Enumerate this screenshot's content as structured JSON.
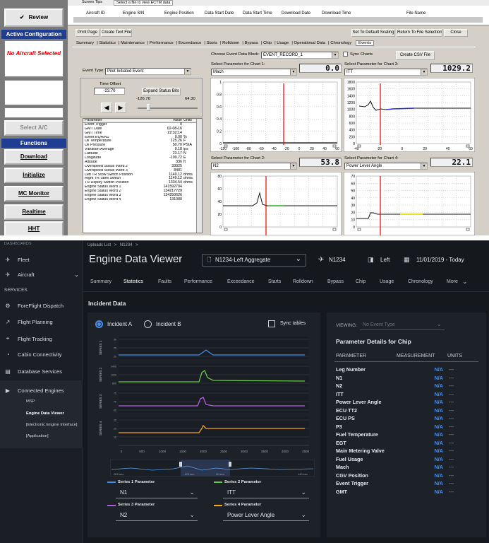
{
  "legacy": {
    "screen_tips": "Screen Tips",
    "screen_tip_text": "Select a file to view ECTM data",
    "file_columns": [
      "Aircraft ID",
      "Engine S/N",
      "Engine Position",
      "Data Start Date",
      "Data Start Time",
      "Download Date",
      "Download Time",
      "File Name"
    ],
    "sidebar": {
      "review": "Review",
      "active_config": "Active Configuration",
      "no_aircraft": "No Aircraft Selected",
      "select_ac": "Select A/C",
      "functions": "Functions",
      "download": "Download",
      "initialize": "Initialize",
      "mc_monitor": "MC Monitor",
      "realtime": "Realtime",
      "hht": "HHT"
    },
    "toolbar": {
      "print_page": "Print Page",
      "create_text_file": "Create Text File",
      "set_default_scaling": "Set To Default Scaling",
      "return_file_selection": "Return To File Selection",
      "close": "Close"
    },
    "tabs": [
      "Summary",
      "Statistics",
      "Maintenance",
      "Performance",
      "Exceedance",
      "Starts",
      "Rolldown",
      "Bypass",
      "Chip",
      "Usage",
      "Operational Data",
      "Chronology",
      "Events"
    ],
    "choose_event_label": "Choose Event Data Block:",
    "event_block": "EVENT_RECORD_1",
    "sync_charts": "Sync Charts",
    "create_csv": "Create CSV File",
    "event_type_label": "Event Type:",
    "event_type": "Pilot Initiated Event",
    "time_offset_label": "Time Offset",
    "time_offset": "-23.70",
    "expand_status": "Expand Status Bits",
    "range_min": "-126.70",
    "range_max": "64.30",
    "chart_labels": [
      "Select Parameter for Chart 1:",
      "Select Parameter for Chart 2:",
      "Select Parameter for Chart 3:",
      "Select Parameter for Chart 4:"
    ],
    "chart_params": [
      "Mach",
      "N2",
      "ITT",
      "Power Lever Angle"
    ],
    "chart_lcd": [
      "0.0",
      "53.8",
      "1029.2",
      "22.1"
    ],
    "table_headers": [
      "Parameter",
      "Value",
      "Units"
    ],
    "table_rows": [
      [
        "Event Trigger",
        "0",
        ""
      ],
      [
        "GMT Date",
        "02-08-16",
        ""
      ],
      [
        "GMT Time",
        "22:32:14",
        ""
      ],
      [
        "Event EQA/N1",
        "0.00",
        "%"
      ],
      [
        "Oil Temperature",
        "125.26",
        "F"
      ],
      [
        "Oil Pressure",
        "50.70",
        "PSIA"
      ],
      [
        "Vibration Average",
        "0.18",
        "ips"
      ],
      [
        "Latitude",
        "23.17",
        "N"
      ],
      [
        "Longitude",
        "-109.72",
        "E"
      ],
      [
        "Altitude",
        "336",
        "ft"
      ],
      [
        "Overspeed Status Word 2",
        "33025",
        ""
      ],
      [
        "Overspeed Status Word 3",
        "8481",
        ""
      ],
      [
        "Left TR Stow Switch Position",
        "1149.12",
        "ohms"
      ],
      [
        "Right TR Stow Switch",
        "1149.12",
        "ohms"
      ],
      [
        "TR Deploy Switch Position",
        "1334.54",
        "ohms"
      ],
      [
        "Engine Status Word 1",
        "141592704",
        ""
      ],
      [
        "Engine Status Word 2",
        "134217729",
        ""
      ],
      [
        "Engine Status Word 3",
        "134250626",
        ""
      ],
      [
        "Engine Status Word 4",
        "131080",
        ""
      ]
    ],
    "chart1": {
      "x_ticks": [
        "-120",
        "-100",
        "-80",
        "-60",
        "-40",
        "-20",
        "0",
        "20",
        "40",
        "60"
      ],
      "y_ticks": [
        "1",
        "0.8",
        "0.6",
        "0.4",
        "0.2",
        "0"
      ]
    },
    "chart3": {
      "x_ticks": [
        "-40",
        "-20",
        "0",
        "20",
        "40",
        "60"
      ],
      "y_ticks": [
        "1800",
        "1600",
        "1400",
        "1200",
        "1000",
        "800",
        "600",
        "400",
        "200",
        "0"
      ]
    },
    "chart2": {
      "y_ticks": [
        "80",
        "60",
        "40",
        "20",
        "0"
      ]
    },
    "chart4": {
      "y_ticks": [
        "70",
        "60",
        "50",
        "40",
        "30",
        "20",
        "10",
        "0"
      ]
    }
  },
  "modern": {
    "nav": {
      "dashboards": "DASHBOARDS",
      "fleet": "Fleet",
      "aircraft": "Aircraft",
      "services": "SERVICES",
      "foreflight": "ForeFlight Dispatch",
      "flight_planning": "Flight Planning",
      "flight_tracking": "Flight Tracking",
      "cabin": "Cabin Connectivity",
      "database": "Database Services",
      "connected_engines": "Connected Engines",
      "msp": "MSP",
      "engine_viewer": "Engine Data Viewer",
      "eei": "[Electronic Engine Interface]",
      "application": "[Application]"
    },
    "breadcrumb": [
      "Uploads List",
      ">",
      "N1234",
      ">"
    ],
    "page_title": "Engine Data Viewer",
    "file_select": "N1234-Left Aggregate",
    "aircraft": "N1234",
    "engine_side": "Left",
    "date_range": "11/01/2019 - Today",
    "tabs": [
      "Summary",
      "Statistics",
      "Faults",
      "Performance",
      "Exceedance",
      "Starts",
      "Rolldown",
      "Bypass",
      "Chip",
      "Usage",
      "Chronology",
      "More"
    ],
    "section_title": "Incident Data",
    "incident_a": "Incident A",
    "incident_b": "Incident B",
    "sync_tables": "Sync tables",
    "series_labels": [
      "SERIES 1",
      "SERIES 2",
      "SERIES 3",
      "SERIES 4"
    ],
    "s1_ticks": [
      "30",
      "25",
      "20"
    ],
    "s2_ticks": [
      "1400",
      "1000",
      "800"
    ],
    "s3_ticks": [
      "75",
      "70",
      "65"
    ],
    "s4_ticks": [
      "25",
      "20",
      "15"
    ],
    "x_ticks": [
      "0",
      "500",
      "1000",
      "1500",
      "2000",
      "2500",
      "3000",
      "3500",
      "4000",
      "4500"
    ],
    "scrub_labels": [
      "-300 sec",
      "-125 sec",
      "30 sec",
      "140 sec"
    ],
    "series_params": [
      {
        "label": "Series 1 Parameter",
        "value": "N1",
        "color": "#3b8eea"
      },
      {
        "label": "Series 2 Parameter",
        "value": "ITT",
        "color": "#69c944"
      },
      {
        "label": "Series 3 Parameter",
        "value": "N2",
        "color": "#b65be0"
      },
      {
        "label": "Series 4 Parameter",
        "value": "Power Lever Angle",
        "color": "#f5a623"
      }
    ],
    "viewing_label": "VIEWING:",
    "viewing_value": "No Event Type",
    "details_title": "Parameter Details for Chip",
    "details_headers": [
      "PARAMETER",
      "MEASUREMENT",
      "UNITS"
    ],
    "details_rows": [
      [
        "Leg Number",
        "N/A",
        "---"
      ],
      [
        "N1",
        "N/A",
        "---"
      ],
      [
        "N2",
        "N/A",
        "---"
      ],
      [
        "ITT",
        "N/A",
        "---"
      ],
      [
        "Power Lever Angle",
        "N/A",
        "---"
      ],
      [
        "ECU TT2",
        "N/A",
        "---"
      ],
      [
        "ECU PS",
        "N/A",
        "---"
      ],
      [
        "P3",
        "N/A",
        "---"
      ],
      [
        "Fuel Temperature",
        "N/A",
        "---"
      ],
      [
        "EGT",
        "N/A",
        "---"
      ],
      [
        "Main Metering Valve",
        "N/A",
        "---"
      ],
      [
        "Fuel Usage",
        "N/A",
        "---"
      ],
      [
        "Mach",
        "N/A",
        "---"
      ],
      [
        "CGV Position",
        "N/A",
        "---"
      ],
      [
        "Event Trigger",
        "N/A",
        "---"
      ],
      [
        "GMT",
        "N/A",
        "---"
      ]
    ]
  }
}
